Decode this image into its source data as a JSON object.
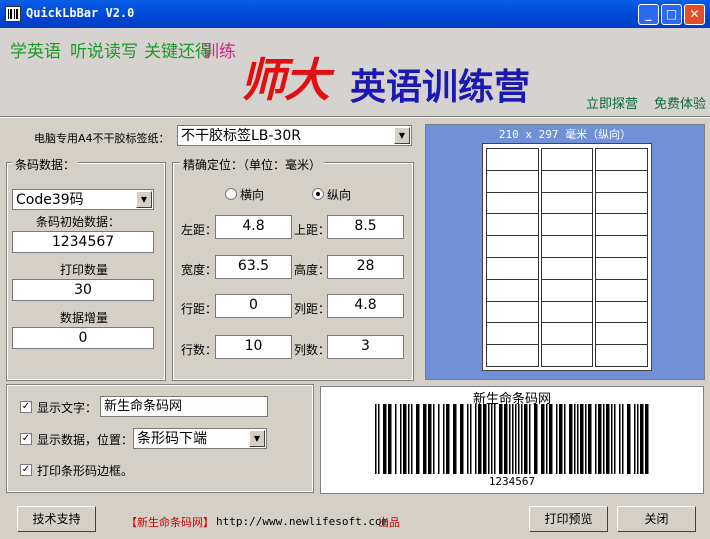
{
  "window": {
    "title": "QuickLbBar V2.0"
  },
  "banner": {
    "slogan_1": "学英语",
    "slogan_2": "听说读写",
    "slogan_3": "关键还得",
    "slogan_3b": "训练",
    "big_text": "师大",
    "mid_text": "英语训练营",
    "link_signup": "立即探营",
    "link_trial": "免费体验"
  },
  "paper": {
    "label": "电脑专用A4不干胶标签纸：",
    "selected": "不干胶标签LB-30R"
  },
  "barcode_data": {
    "group_title": "条码数据：",
    "type_selected": "Code39码",
    "initial_label": "条码初始数据：",
    "initial_value": "1234567",
    "print_qty_label": "打印数量",
    "print_qty_value": "30",
    "increment_label": "数据增量",
    "increment_value": "0"
  },
  "positioning": {
    "group_title": "精确定位：（单位：毫米）",
    "orient_landscape": "横向",
    "orient_portrait": "纵向",
    "left_label": "左距：",
    "left_value": "4.8",
    "top_label": "上距：",
    "top_value": "8.5",
    "width_label": "宽度：",
    "width_value": "63.5",
    "height_label": "高度：",
    "height_value": "28",
    "rowgap_label": "行距：",
    "rowgap_value": "0",
    "colgap_label": "列距：",
    "colgap_value": "4.8",
    "rows_label": "行数：",
    "rows_value": "10",
    "cols_label": "列数：",
    "cols_value": "3"
  },
  "preview": {
    "caption": "210 x 297 毫米（纵向）",
    "rows": 10,
    "cols": 3
  },
  "options": {
    "show_text_label": "显示文字：",
    "show_text_value": "新生命条码网",
    "show_data_label": "显示数据，位置：",
    "show_data_position": "条形码下端",
    "print_border_label": "打印条形码边框。"
  },
  "barcode": {
    "title": "新生命条码网",
    "number": "1234567"
  },
  "footer": {
    "support_button": "技术支持",
    "brand": "【新生命条码网】",
    "url": "http://www.newlifesoft.com",
    "suffix": "出品",
    "preview_button": "打印预览",
    "close_button": "关闭"
  },
  "colors": {
    "title_bar": "#0046d5",
    "preview_bg": "#7090d8",
    "brand_red": "#cc0000"
  }
}
